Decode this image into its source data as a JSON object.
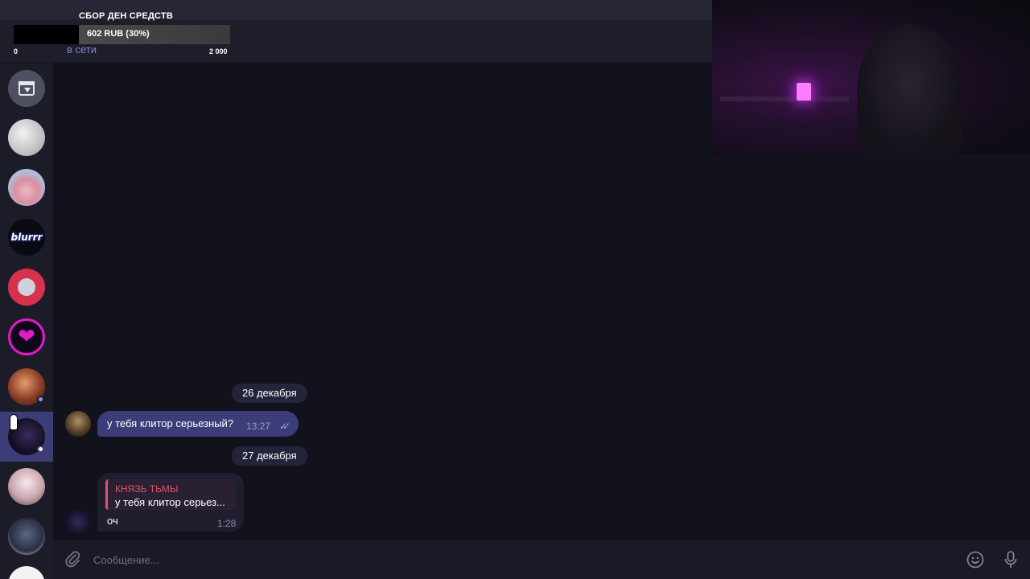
{
  "donation": {
    "title": "СБОР ДЕН СРЕДСТВ",
    "amount": "602 RUB (30%)",
    "progress": 0.3,
    "min": "0",
    "max": "2 000"
  },
  "header": {
    "status": "в сети"
  },
  "sidebar": {
    "items": [
      {
        "name": "archive",
        "icon": "archive-icon"
      },
      {
        "name": "chat-1"
      },
      {
        "name": "chat-2"
      },
      {
        "name": "chat-3",
        "label": "blurrr"
      },
      {
        "name": "chat-4"
      },
      {
        "name": "chat-5",
        "icon": "broken-heart-icon"
      },
      {
        "name": "chat-6",
        "online": true
      },
      {
        "name": "chat-7",
        "active": true,
        "online": true
      },
      {
        "name": "chat-8"
      },
      {
        "name": "chat-9"
      },
      {
        "name": "chat-10"
      }
    ]
  },
  "messages": {
    "date1": "26 декабря",
    "msg1": {
      "text": "у тебя клитор серьезный?",
      "time": "13:27",
      "status": "read"
    },
    "date2": "27 декабря",
    "msg2": {
      "reply_name": "КНЯЗЬ ТЬМЫ",
      "reply_text": "у тебя клитор серьез...",
      "text": "оч",
      "time": "1:28"
    }
  },
  "composer": {
    "placeholder": "Сообщение..."
  },
  "colors": {
    "accent": "#3b3c78",
    "reply_accent": "#e0526a",
    "online": "#7b84d6"
  }
}
